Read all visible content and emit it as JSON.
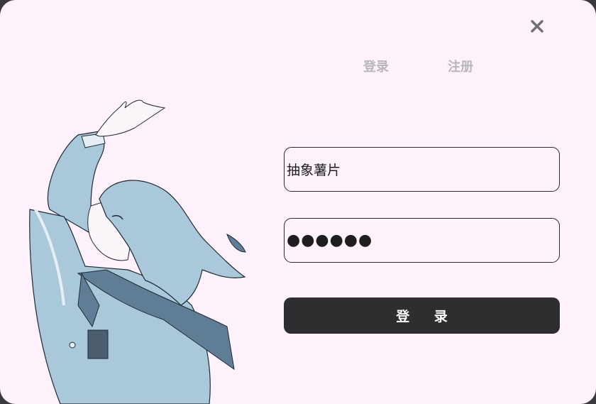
{
  "dialog": {
    "close_icon": "close-icon",
    "tabs": [
      {
        "label": "登录",
        "active": true
      },
      {
        "label": "注册",
        "active": false
      }
    ],
    "username": {
      "value": "抽象薯片"
    },
    "password": {
      "value": "●●●●●●"
    },
    "submit_label": "登 录",
    "colors": {
      "background": "#fdf2fc",
      "tab_text": "#b7b7b7",
      "button_bg": "#2e2d2f",
      "illustration": "#a8c8d8"
    }
  }
}
